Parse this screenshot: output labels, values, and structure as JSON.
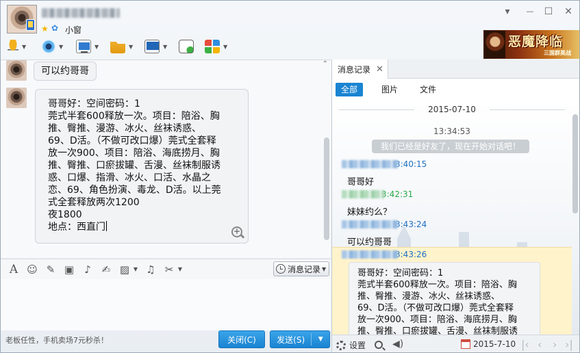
{
  "header": {
    "status": "小窗",
    "controls": {
      "dropdown": "▾",
      "minimize": "—",
      "maximize": "☐",
      "close": "✕"
    }
  },
  "ad": {
    "title": "恶魔降临",
    "subtitle": "三国群英战"
  },
  "chat": {
    "message_short": "可以约哥哥",
    "message_long": [
      "哥哥好：空间密码：1",
      "莞式半套600释放一次。项目：陪浴、胸",
      "推、臀推、漫游、冰火、丝袜诱惑、",
      "69、D活。（不做可改口爆）莞式全套释",
      "放一次900、项目：陪浴、海底捞月、胸",
      "推、臀推、口瘀拔罐、舌漫、丝袜制服诱",
      "惑、口爆、指滑、冰火、口活、水晶之",
      "恋、69、角色扮演、毒龙、D活。以上莞",
      "式全套释放两次1200",
      "夜1800",
      "地点：西直门"
    ]
  },
  "input_toolbar": {
    "history_label": "消息记录"
  },
  "footer": {
    "ad_text": "老板任性，手机卖场7元秒杀！",
    "close_label": "关闭(C)",
    "send_label": "发送(S)"
  },
  "history": {
    "tab_label": "消息记录",
    "filters": [
      "全部",
      "图片",
      "文件"
    ],
    "date": "2015-07-10",
    "time_center": "13:34:53",
    "system_message": "我们已经是好友了，现在开始对话吧！",
    "messages": [
      {
        "time": "3:40:15",
        "text": "哥哥好"
      },
      {
        "time": "3:42:31",
        "text": "妹妹约么？"
      },
      {
        "time": "3:43:24",
        "text": "可以约哥哥"
      },
      {
        "time": "3:43:26"
      }
    ],
    "bubble_lines": [
      "哥哥好：空间密码：1",
      "莞式半套600释放一次。项目：陪浴、胸",
      "推、臀推、漫游、冰火、丝袜诱惑、",
      "69、D活。（不做可改口爆）莞式全套释",
      "放一次900、项目：陪浴、海底捞月、胸",
      "推、臀推、口瘀拔罐、舌漫、丝袜制服诱"
    ],
    "footer": {
      "settings_label": "设置",
      "date": "2015-7-10"
    }
  },
  "colors": {
    "accent": "#1a84d2",
    "highlight": "#fff3cc"
  }
}
